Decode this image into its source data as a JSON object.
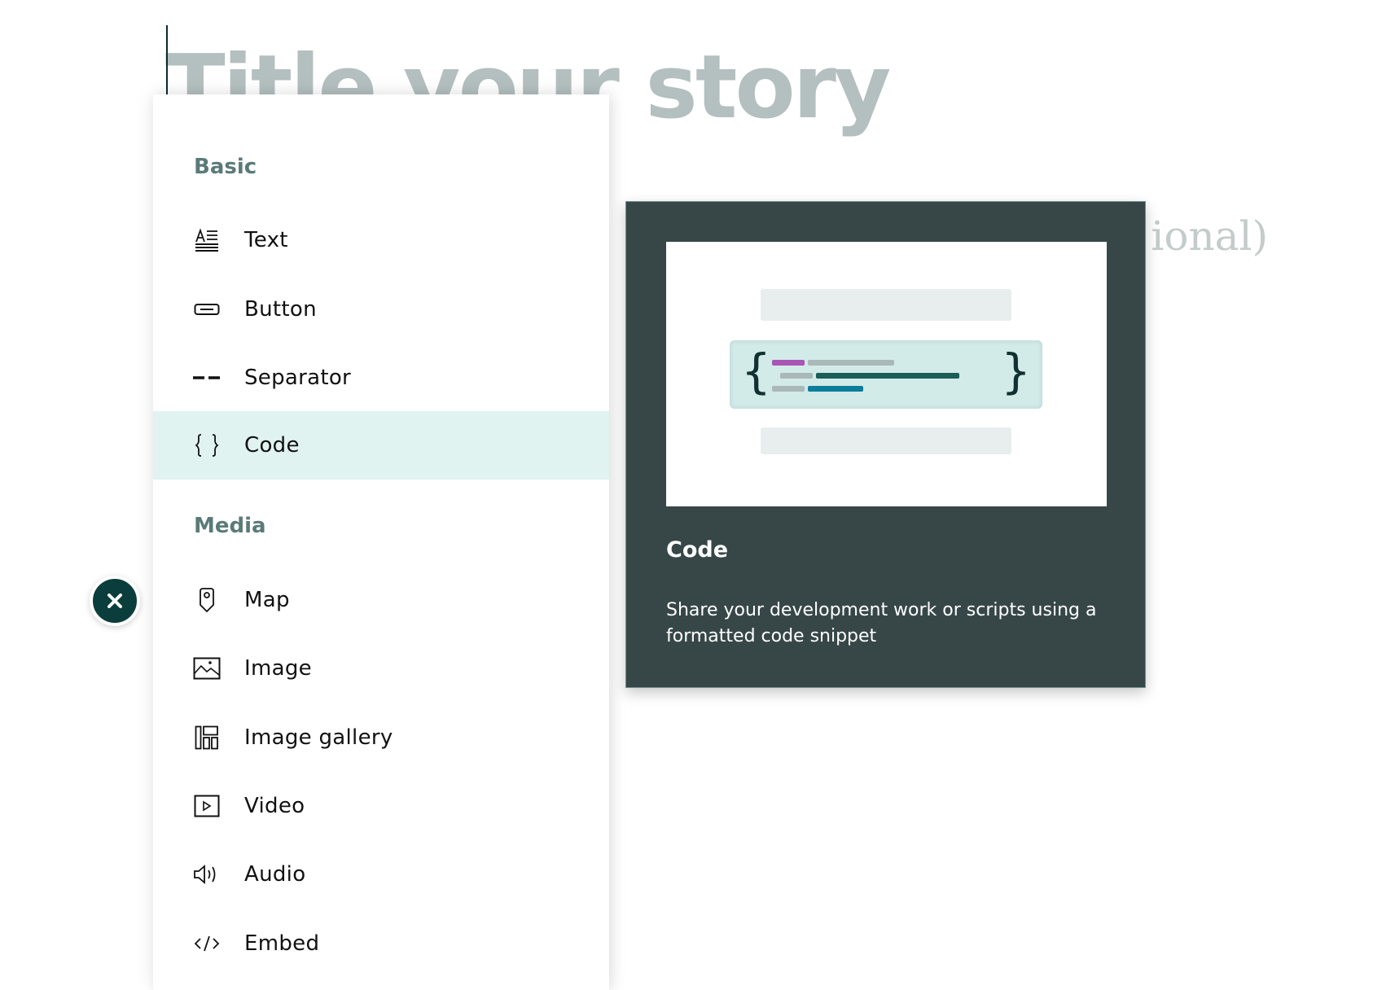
{
  "story": {
    "title_placeholder": "Title your story",
    "subtitle_placeholder": "r                       ional)"
  },
  "menu": {
    "sections": [
      {
        "header": "Basic",
        "items": [
          {
            "label": "Text",
            "icon": "text-icon"
          },
          {
            "label": "Button",
            "icon": "button-icon"
          },
          {
            "label": "Separator",
            "icon": "separator-icon"
          },
          {
            "label": "Code",
            "icon": "code-braces-icon",
            "selected": true
          }
        ]
      },
      {
        "header": "Media",
        "items": [
          {
            "label": "Map",
            "icon": "map-pin-icon"
          },
          {
            "label": "Image",
            "icon": "image-icon"
          },
          {
            "label": "Image gallery",
            "icon": "image-gallery-icon"
          },
          {
            "label": "Video",
            "icon": "video-icon"
          },
          {
            "label": "Audio",
            "icon": "audio-icon"
          },
          {
            "label": "Embed",
            "icon": "embed-icon"
          }
        ]
      }
    ]
  },
  "close_button": {
    "icon": "close-icon",
    "label": "×"
  },
  "preview": {
    "title": "Code",
    "description": "Share your development work or scripts using a formatted code snippet",
    "braces": {
      "open": "{",
      "close": "}"
    }
  },
  "colors": {
    "accent_dark": "#0a3d3b",
    "section_header": "#5a7a78",
    "selected_bg": "#e0f3f1",
    "preview_bg": "#374748",
    "code_purple": "#a855b5",
    "code_green": "#1a5e58",
    "code_blue": "#0b7d9a",
    "code_gray": "#aab8b8"
  }
}
